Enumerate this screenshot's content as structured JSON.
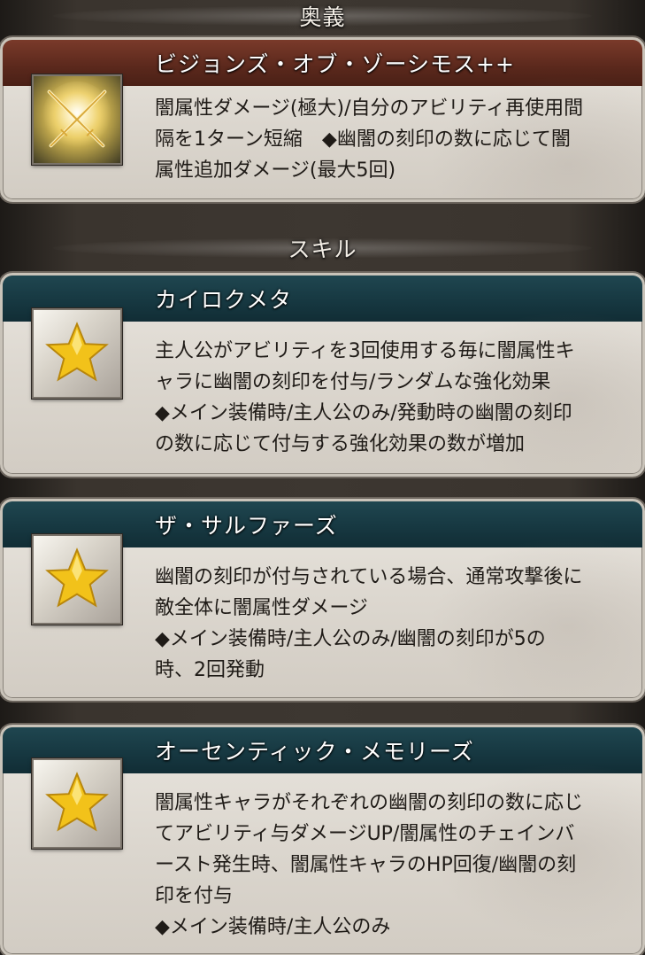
{
  "sections": {
    "ougi": "奥義",
    "skill": "スキル"
  },
  "ougi": {
    "name": "ビジョンズ・オブ・ゾーシモス++",
    "icon": "crossed-swords-icon",
    "lines": [
      "闇属性ダメージ(極大)/自分のアビリティ再使用間",
      "隔を1ターン短縮　◆幽闇の刻印の数に応じて闇",
      "属性追加ダメージ(最大5回)"
    ]
  },
  "skills": [
    {
      "name": "カイロクメタ",
      "icon": "star-icon",
      "lines": [
        "主人公がアビリティを3回使用する毎に闇属性キ",
        "ャラに幽闇の刻印を付与/ランダムな強化効果",
        "◆メイン装備時/主人公のみ/発動時の幽闇の刻印",
        "の数に応じて付与する強化効果の数が増加"
      ]
    },
    {
      "name": "ザ・サルファーズ",
      "icon": "star-icon",
      "lines": [
        "幽闇の刻印が付与されている場合、通常攻撃後に",
        "敵全体に闇属性ダメージ",
        "◆メイン装備時/主人公のみ/幽闇の刻印が5の",
        "時、2回発動"
      ]
    },
    {
      "name": "オーセンティック・メモリーズ",
      "icon": "star-icon",
      "lines": [
        "闇属性キャラがそれぞれの幽闇の刻印の数に応じ",
        "てアビリティ与ダメージUP/闇属性のチェインバ",
        "ースト発生時、闇属性キャラのHP回復/幽闇の刻",
        "印を付与",
        "◆メイン装備時/主人公のみ"
      ]
    }
  ],
  "colors": {
    "ougi_banner": "#5a281c",
    "skill_banner": "#163740",
    "star": "#f2c21a"
  }
}
